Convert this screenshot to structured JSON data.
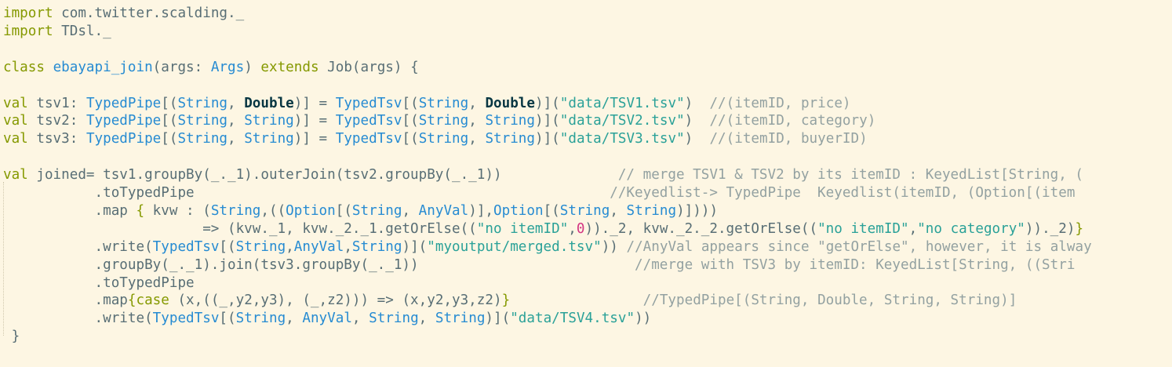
{
  "editor": {
    "colors": {
      "background": "#fdf6e3",
      "plain": "#586e75",
      "keyword": "#859900",
      "type": "#268bd2",
      "string": "#2aa198",
      "comment": "#93a1a1",
      "number": "#d33682",
      "bold": "#073642"
    },
    "lines": [
      {
        "tokens": [
          {
            "t": "import",
            "c": "kw"
          },
          {
            "t": " com.twitter.scalding._",
            "c": "pl"
          }
        ]
      },
      {
        "tokens": [
          {
            "t": "import",
            "c": "kw"
          },
          {
            "t": " TDsl._",
            "c": "pl"
          }
        ]
      },
      {
        "tokens": []
      },
      {
        "tokens": [
          {
            "t": "class",
            "c": "kw"
          },
          {
            "t": " ",
            "c": "pl"
          },
          {
            "t": "ebayapi_join",
            "c": "df"
          },
          {
            "t": "(args: ",
            "c": "pl"
          },
          {
            "t": "Args",
            "c": "ty"
          },
          {
            "t": ") ",
            "c": "pl"
          },
          {
            "t": "extends",
            "c": "kw"
          },
          {
            "t": " Job(args) {",
            "c": "pl"
          }
        ]
      },
      {
        "tokens": []
      },
      {
        "tokens": [
          {
            "t": "val",
            "c": "kw"
          },
          {
            "t": " tsv1: ",
            "c": "pl"
          },
          {
            "t": "TypedPipe",
            "c": "ty"
          },
          {
            "t": "[(",
            "c": "pl"
          },
          {
            "t": "String",
            "c": "ty"
          },
          {
            "t": ", ",
            "c": "pl"
          },
          {
            "t": "Double",
            "c": "bd"
          },
          {
            "t": ")] = ",
            "c": "pl"
          },
          {
            "t": "TypedTsv",
            "c": "ty"
          },
          {
            "t": "[(",
            "c": "pl"
          },
          {
            "t": "String",
            "c": "ty"
          },
          {
            "t": ", ",
            "c": "pl"
          },
          {
            "t": "Double",
            "c": "bd"
          },
          {
            "t": ")](",
            "c": "pl"
          },
          {
            "t": "\"data/TSV1.tsv\"",
            "c": "st"
          },
          {
            "t": ")  ",
            "c": "pl"
          },
          {
            "t": "//(itemID, price)",
            "c": "cm"
          }
        ]
      },
      {
        "tokens": [
          {
            "t": "val",
            "c": "kw"
          },
          {
            "t": " tsv2: ",
            "c": "pl"
          },
          {
            "t": "TypedPipe",
            "c": "ty"
          },
          {
            "t": "[(",
            "c": "pl"
          },
          {
            "t": "String",
            "c": "ty"
          },
          {
            "t": ", ",
            "c": "pl"
          },
          {
            "t": "String",
            "c": "ty"
          },
          {
            "t": ")] = ",
            "c": "pl"
          },
          {
            "t": "TypedTsv",
            "c": "ty"
          },
          {
            "t": "[(",
            "c": "pl"
          },
          {
            "t": "String",
            "c": "ty"
          },
          {
            "t": ", ",
            "c": "pl"
          },
          {
            "t": "String",
            "c": "ty"
          },
          {
            "t": ")](",
            "c": "pl"
          },
          {
            "t": "\"data/TSV2.tsv\"",
            "c": "st"
          },
          {
            "t": ")  ",
            "c": "pl"
          },
          {
            "t": "//(itemID, category)",
            "c": "cm"
          }
        ]
      },
      {
        "tokens": [
          {
            "t": "val",
            "c": "kw"
          },
          {
            "t": " tsv3: ",
            "c": "pl"
          },
          {
            "t": "TypedPipe",
            "c": "ty"
          },
          {
            "t": "[(",
            "c": "pl"
          },
          {
            "t": "String",
            "c": "ty"
          },
          {
            "t": ", ",
            "c": "pl"
          },
          {
            "t": "String",
            "c": "ty"
          },
          {
            "t": ")] = ",
            "c": "pl"
          },
          {
            "t": "TypedTsv",
            "c": "ty"
          },
          {
            "t": "[(",
            "c": "pl"
          },
          {
            "t": "String",
            "c": "ty"
          },
          {
            "t": ", ",
            "c": "pl"
          },
          {
            "t": "String",
            "c": "ty"
          },
          {
            "t": ")](",
            "c": "pl"
          },
          {
            "t": "\"data/TSV3.tsv\"",
            "c": "st"
          },
          {
            "t": ")  ",
            "c": "pl"
          },
          {
            "t": "//(itemID, buyerID)",
            "c": "cm"
          }
        ]
      },
      {
        "tokens": []
      },
      {
        "tokens": [
          {
            "t": "val",
            "c": "kw"
          },
          {
            "t": " joined= tsv1.groupBy(_._1).outerJoin(tsv2.groupBy(_._1))              ",
            "c": "pl"
          },
          {
            "t": "// merge TSV1 & TSV2 by its itemID : KeyedList[String, (",
            "c": "cm"
          }
        ]
      },
      {
        "tokens": [
          {
            "t": "           .toTypedPipe                                                  ",
            "c": "pl"
          },
          {
            "t": "//Keyedlist-> TypedPipe  Keyedlist(itemID, (Option[(item",
            "c": "cm"
          }
        ]
      },
      {
        "tokens": [
          {
            "t": "           .map ",
            "c": "pl"
          },
          {
            "t": "{",
            "c": "kw"
          },
          {
            "t": " kvw : (",
            "c": "pl"
          },
          {
            "t": "String",
            "c": "ty"
          },
          {
            "t": ",((",
            "c": "pl"
          },
          {
            "t": "Option",
            "c": "ty"
          },
          {
            "t": "[(",
            "c": "pl"
          },
          {
            "t": "String",
            "c": "ty"
          },
          {
            "t": ", ",
            "c": "pl"
          },
          {
            "t": "AnyVal",
            "c": "ty"
          },
          {
            "t": ")],",
            "c": "pl"
          },
          {
            "t": "Option",
            "c": "ty"
          },
          {
            "t": "[(",
            "c": "pl"
          },
          {
            "t": "String",
            "c": "ty"
          },
          {
            "t": ", ",
            "c": "pl"
          },
          {
            "t": "String",
            "c": "ty"
          },
          {
            "t": ")])))",
            "c": "pl"
          }
        ]
      },
      {
        "tokens": [
          {
            "t": "                        => (kvw._1, kvw._2._1.getOrElse((",
            "c": "pl"
          },
          {
            "t": "\"no itemID\"",
            "c": "st"
          },
          {
            "t": ",",
            "c": "pl"
          },
          {
            "t": "0",
            "c": "nu"
          },
          {
            "t": "))._2, kvw._2._2.getOrElse((",
            "c": "pl"
          },
          {
            "t": "\"no itemID\"",
            "c": "st"
          },
          {
            "t": ",",
            "c": "pl"
          },
          {
            "t": "\"no category\"",
            "c": "st"
          },
          {
            "t": "))._2)",
            "c": "pl"
          },
          {
            "t": "}",
            "c": "kw"
          }
        ]
      },
      {
        "tokens": [
          {
            "t": "           .write(",
            "c": "pl"
          },
          {
            "t": "TypedTsv",
            "c": "ty"
          },
          {
            "t": "[(",
            "c": "pl"
          },
          {
            "t": "String",
            "c": "ty"
          },
          {
            "t": ",",
            "c": "pl"
          },
          {
            "t": "AnyVal",
            "c": "ty"
          },
          {
            "t": ",",
            "c": "pl"
          },
          {
            "t": "String",
            "c": "ty"
          },
          {
            "t": ")](",
            "c": "pl"
          },
          {
            "t": "\"myoutput/merged.tsv\"",
            "c": "st"
          },
          {
            "t": ")) ",
            "c": "pl"
          },
          {
            "t": "//AnyVal appears since \"getOrElse\", however, it is alway",
            "c": "cm"
          }
        ]
      },
      {
        "tokens": [
          {
            "t": "           .groupBy(_._1).join(tsv3.groupBy(_._1))                          ",
            "c": "pl"
          },
          {
            "t": "//merge with TSV3 by itemID: KeyedList[String, ((Stri",
            "c": "cm"
          }
        ]
      },
      {
        "tokens": [
          {
            "t": "           .toTypedPipe",
            "c": "pl"
          }
        ]
      },
      {
        "tokens": [
          {
            "t": "           .map",
            "c": "pl"
          },
          {
            "t": "{",
            "c": "kw"
          },
          {
            "t": "case",
            "c": "kw"
          },
          {
            "t": " (x,((_,y2,y3), (_,z2))) => (x,y2,y3,z2)",
            "c": "pl"
          },
          {
            "t": "}",
            "c": "kw"
          },
          {
            "t": "                ",
            "c": "pl"
          },
          {
            "t": "//TypedPipe[(String, Double, String, String)]",
            "c": "cm"
          }
        ]
      },
      {
        "tokens": [
          {
            "t": "           .write(",
            "c": "pl"
          },
          {
            "t": "TypedTsv",
            "c": "ty"
          },
          {
            "t": "[(",
            "c": "pl"
          },
          {
            "t": "String",
            "c": "ty"
          },
          {
            "t": ", ",
            "c": "pl"
          },
          {
            "t": "AnyVal",
            "c": "ty"
          },
          {
            "t": ", ",
            "c": "pl"
          },
          {
            "t": "String",
            "c": "ty"
          },
          {
            "t": ", ",
            "c": "pl"
          },
          {
            "t": "String",
            "c": "ty"
          },
          {
            "t": ")](",
            "c": "pl"
          },
          {
            "t": "\"data/TSV4.tsv\"",
            "c": "st"
          },
          {
            "t": "))",
            "c": "pl"
          }
        ]
      },
      {
        "tokens": [
          {
            "t": " }",
            "c": "pl"
          }
        ]
      }
    ]
  }
}
